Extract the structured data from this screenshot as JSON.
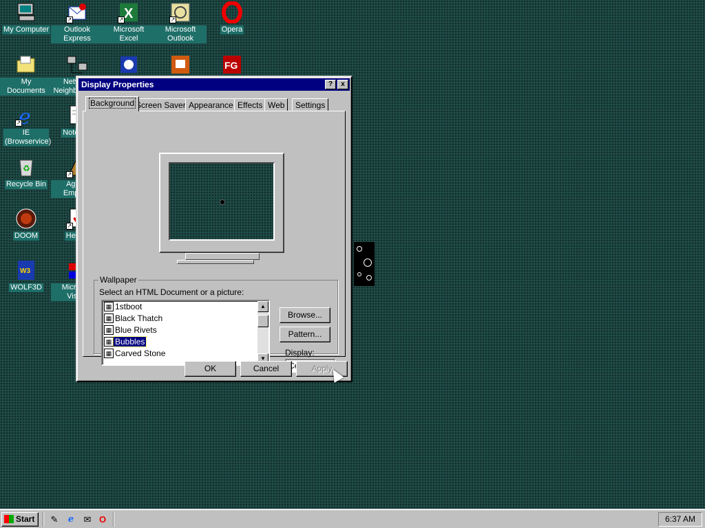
{
  "desktop": {
    "icons": [
      {
        "label": "My Computer",
        "icon": "my-computer-icon"
      },
      {
        "label": "My Documents",
        "icon": "my-documents-icon"
      },
      {
        "label": "IE (Browservice)",
        "icon": "internet-explorer-icon"
      },
      {
        "label": "Recycle Bin",
        "icon": "recycle-bin-icon"
      },
      {
        "label": "DOOM",
        "icon": "doom-icon"
      },
      {
        "label": "WOLF3D",
        "icon": "wolf3d-icon"
      },
      {
        "label": "Outlook Express",
        "icon": "outlook-express-icon"
      },
      {
        "label": "Network Neighborhood",
        "icon": "network-neighborhood-icon"
      },
      {
        "label": "Notepad",
        "icon": "notepad-icon"
      },
      {
        "label": "Age of Empires",
        "icon": "age-of-empires-icon"
      },
      {
        "label": "Hearts",
        "icon": "hearts-icon"
      },
      {
        "label": "Microsoft Visual",
        "icon": "visual-studio-icon"
      },
      {
        "label": "Microsoft Excel",
        "icon": "excel-icon"
      },
      {
        "label": "Microsoft Outlook",
        "icon": "outlook-icon"
      },
      {
        "label": "Opera",
        "icon": "opera-icon"
      }
    ]
  },
  "dialog": {
    "title": "Display Properties",
    "help_btn": "?",
    "close_btn": "x",
    "tabs": [
      "Background",
      "Screen Saver",
      "Appearance",
      "Effects",
      "Web",
      "Settings"
    ],
    "active_tab": "Background",
    "wallpaper": {
      "group_label": "Wallpaper",
      "prompt": "Select an HTML Document or a picture:",
      "items": [
        "1stboot",
        "Black Thatch",
        "Blue Rivets",
        "Bubbles",
        "Carved Stone"
      ],
      "selected": "Bubbles",
      "browse_label": "Browse...",
      "pattern_label": "Pattern...",
      "display_label": "Display:",
      "display_value": "Center"
    },
    "ok_label": "OK",
    "cancel_label": "Cancel",
    "apply_label": "Apply"
  },
  "taskbar": {
    "start_label": "Start",
    "quick_launch": [
      "show-desktop-icon",
      "internet-explorer-icon",
      "outlook-express-icon",
      "opera-icon"
    ],
    "clock": "6:37 AM"
  },
  "colors": {
    "desktop": "#1f4b47",
    "titlebar": "#000080",
    "window": "#c0c0c0"
  }
}
